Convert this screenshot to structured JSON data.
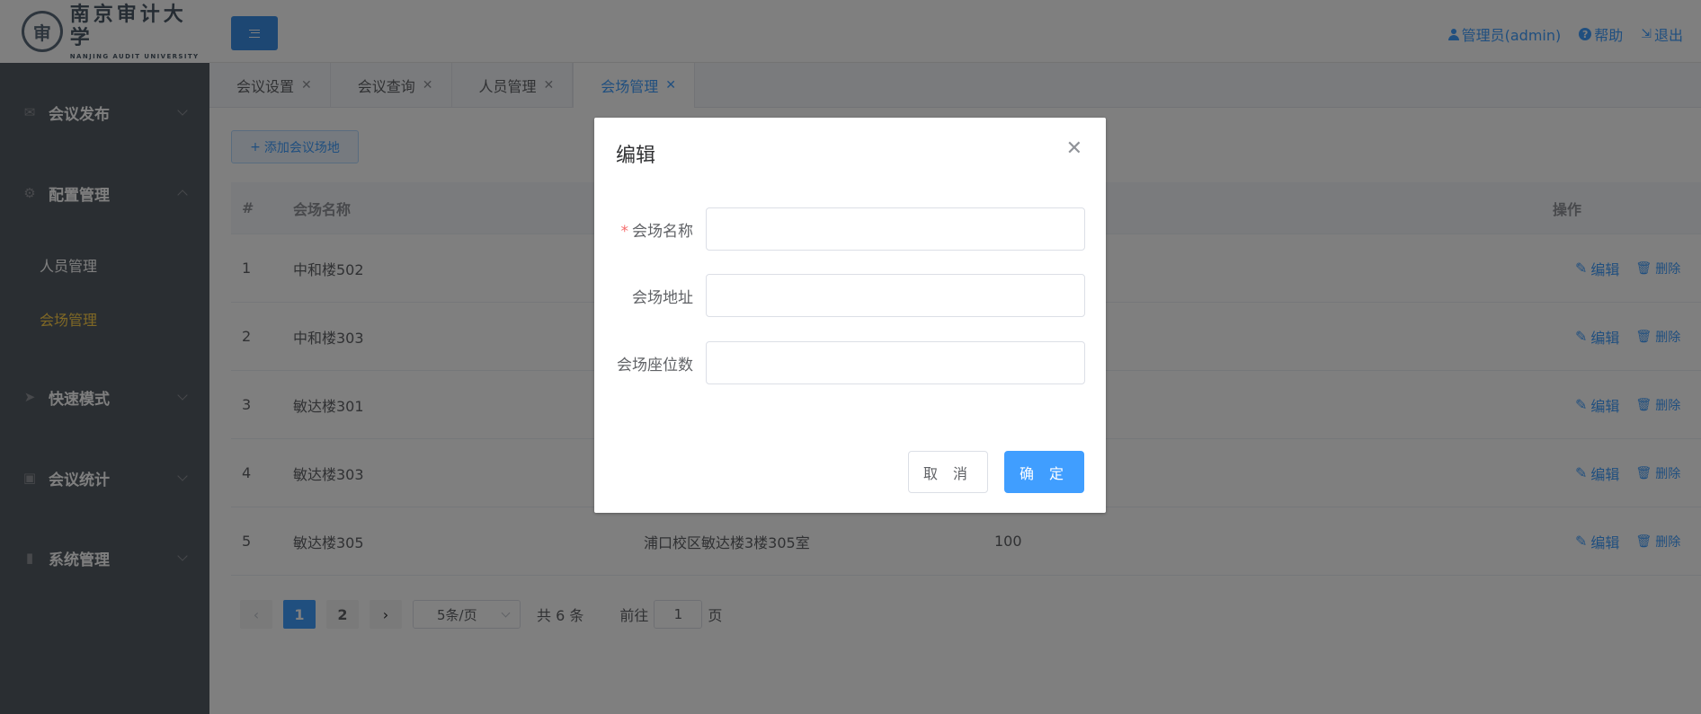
{
  "header": {
    "logo_cn": "南京审计大学",
    "logo_en": "NANJING AUDIT UNIVERSITY",
    "user": "管理员(admin)",
    "help": "帮助",
    "logout": "退出"
  },
  "sidebar": {
    "groups": [
      {
        "label": "会议发布",
        "icon": "mail-icon"
      },
      {
        "label": "配置管理",
        "icon": "gear-icon"
      },
      {
        "label": "快速模式",
        "icon": "send-icon"
      },
      {
        "label": "会议统计",
        "icon": "presentation-icon"
      },
      {
        "label": "系统管理",
        "icon": "books-icon"
      }
    ],
    "subitems": [
      {
        "label": "人员管理"
      },
      {
        "label": "会场管理"
      }
    ]
  },
  "tabs": [
    {
      "label": "会议设置"
    },
    {
      "label": "会议查询"
    },
    {
      "label": "人员管理"
    },
    {
      "label": "会场管理"
    }
  ],
  "toolbar": {
    "add_label": "添加会议场地"
  },
  "table": {
    "headers": {
      "idx": "#",
      "name": "会场名称",
      "op": "操作"
    },
    "rows": [
      {
        "idx": "1",
        "name": "中和楼502",
        "addr": "",
        "seats": ""
      },
      {
        "idx": "2",
        "name": "中和楼303",
        "addr": "",
        "seats": ""
      },
      {
        "idx": "3",
        "name": "敏达楼301",
        "addr": "",
        "seats": ""
      },
      {
        "idx": "4",
        "name": "敏达楼303",
        "addr": "",
        "seats": ""
      },
      {
        "idx": "5",
        "name": "敏达楼305",
        "addr": "浦口校区敏达楼3楼305室",
        "seats": "100"
      }
    ],
    "edit_label": "编辑",
    "delete_label": "删除"
  },
  "pagination": {
    "pages": [
      "1",
      "2"
    ],
    "current": "1",
    "page_size": "5条/页",
    "total": "共 6 条",
    "goto_prefix": "前往",
    "goto_value": "1",
    "goto_suffix": "页"
  },
  "dialog": {
    "title": "编辑",
    "fields": [
      {
        "label": "会场名称",
        "required": true,
        "value": ""
      },
      {
        "label": "会场地址",
        "required": false,
        "value": ""
      },
      {
        "label": "会场座位数",
        "required": false,
        "value": ""
      }
    ],
    "cancel_label": "取 消",
    "ok_label": "确 定"
  },
  "colors": {
    "primary": "#409eff",
    "sidebar_bg": "#545c64",
    "sidebar_active": "#ffd04b"
  }
}
